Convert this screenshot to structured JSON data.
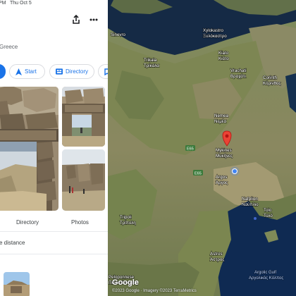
{
  "status": {
    "time": "PM",
    "date": "Thu Oct 5"
  },
  "place": {
    "location": "Greece"
  },
  "actions": {
    "start_label": "Start",
    "directory_label": "Directory"
  },
  "photos": {
    "directory_caption": "Directory",
    "photos_caption": "Photos"
  },
  "section": {
    "distance_label": "e distance"
  },
  "map": {
    "labels": {
      "sinevro": "Sinevro",
      "xylokastro": "Xylokastro",
      "xylokastro_gr": "Ξυλόκαστρο",
      "kiato": "Kiato",
      "kiato_gr": "Κιάτο",
      "trikala": "Trikala",
      "trikala_gr": "Τρίκαλα",
      "vrachati": "Vrachati",
      "vrachati_gr": "Βραχάτι",
      "corinth": "Corinth",
      "corinth_gr": "Κόρινθος",
      "nemea": "Nemea",
      "nemea_gr": "Νεμέα",
      "mykines": "Mykines",
      "mykines_gr": "Μυκήνες",
      "argos": "Argos",
      "argos_gr": "Άργος",
      "nafplion": "Nafplion",
      "nafplion_gr": "Ναύπλιο",
      "tolo": "Tolo",
      "tolo_gr": "Τολό",
      "tripoli": "Tripoli",
      "tripoli_gr": "Τρίπολη",
      "astros": "Astros",
      "astros_gr": "Άστρος",
      "peloponnese": "Peloponnese",
      "peloponnese_gr": "Πελοπόννησος",
      "argolic_gulf": "Argolic Gulf",
      "argolic_gulf_gr": "Αργολικός Κόλπος",
      "road_e65": "E65",
      "road_e65b": "E65"
    },
    "logo": "Google",
    "attribution": "©2023 Google · Imagery ©2023 TerraMetrics"
  },
  "colors": {
    "accent": "#1a73e8",
    "pin": "#ea4335",
    "you_are_here": "#4285f4"
  }
}
